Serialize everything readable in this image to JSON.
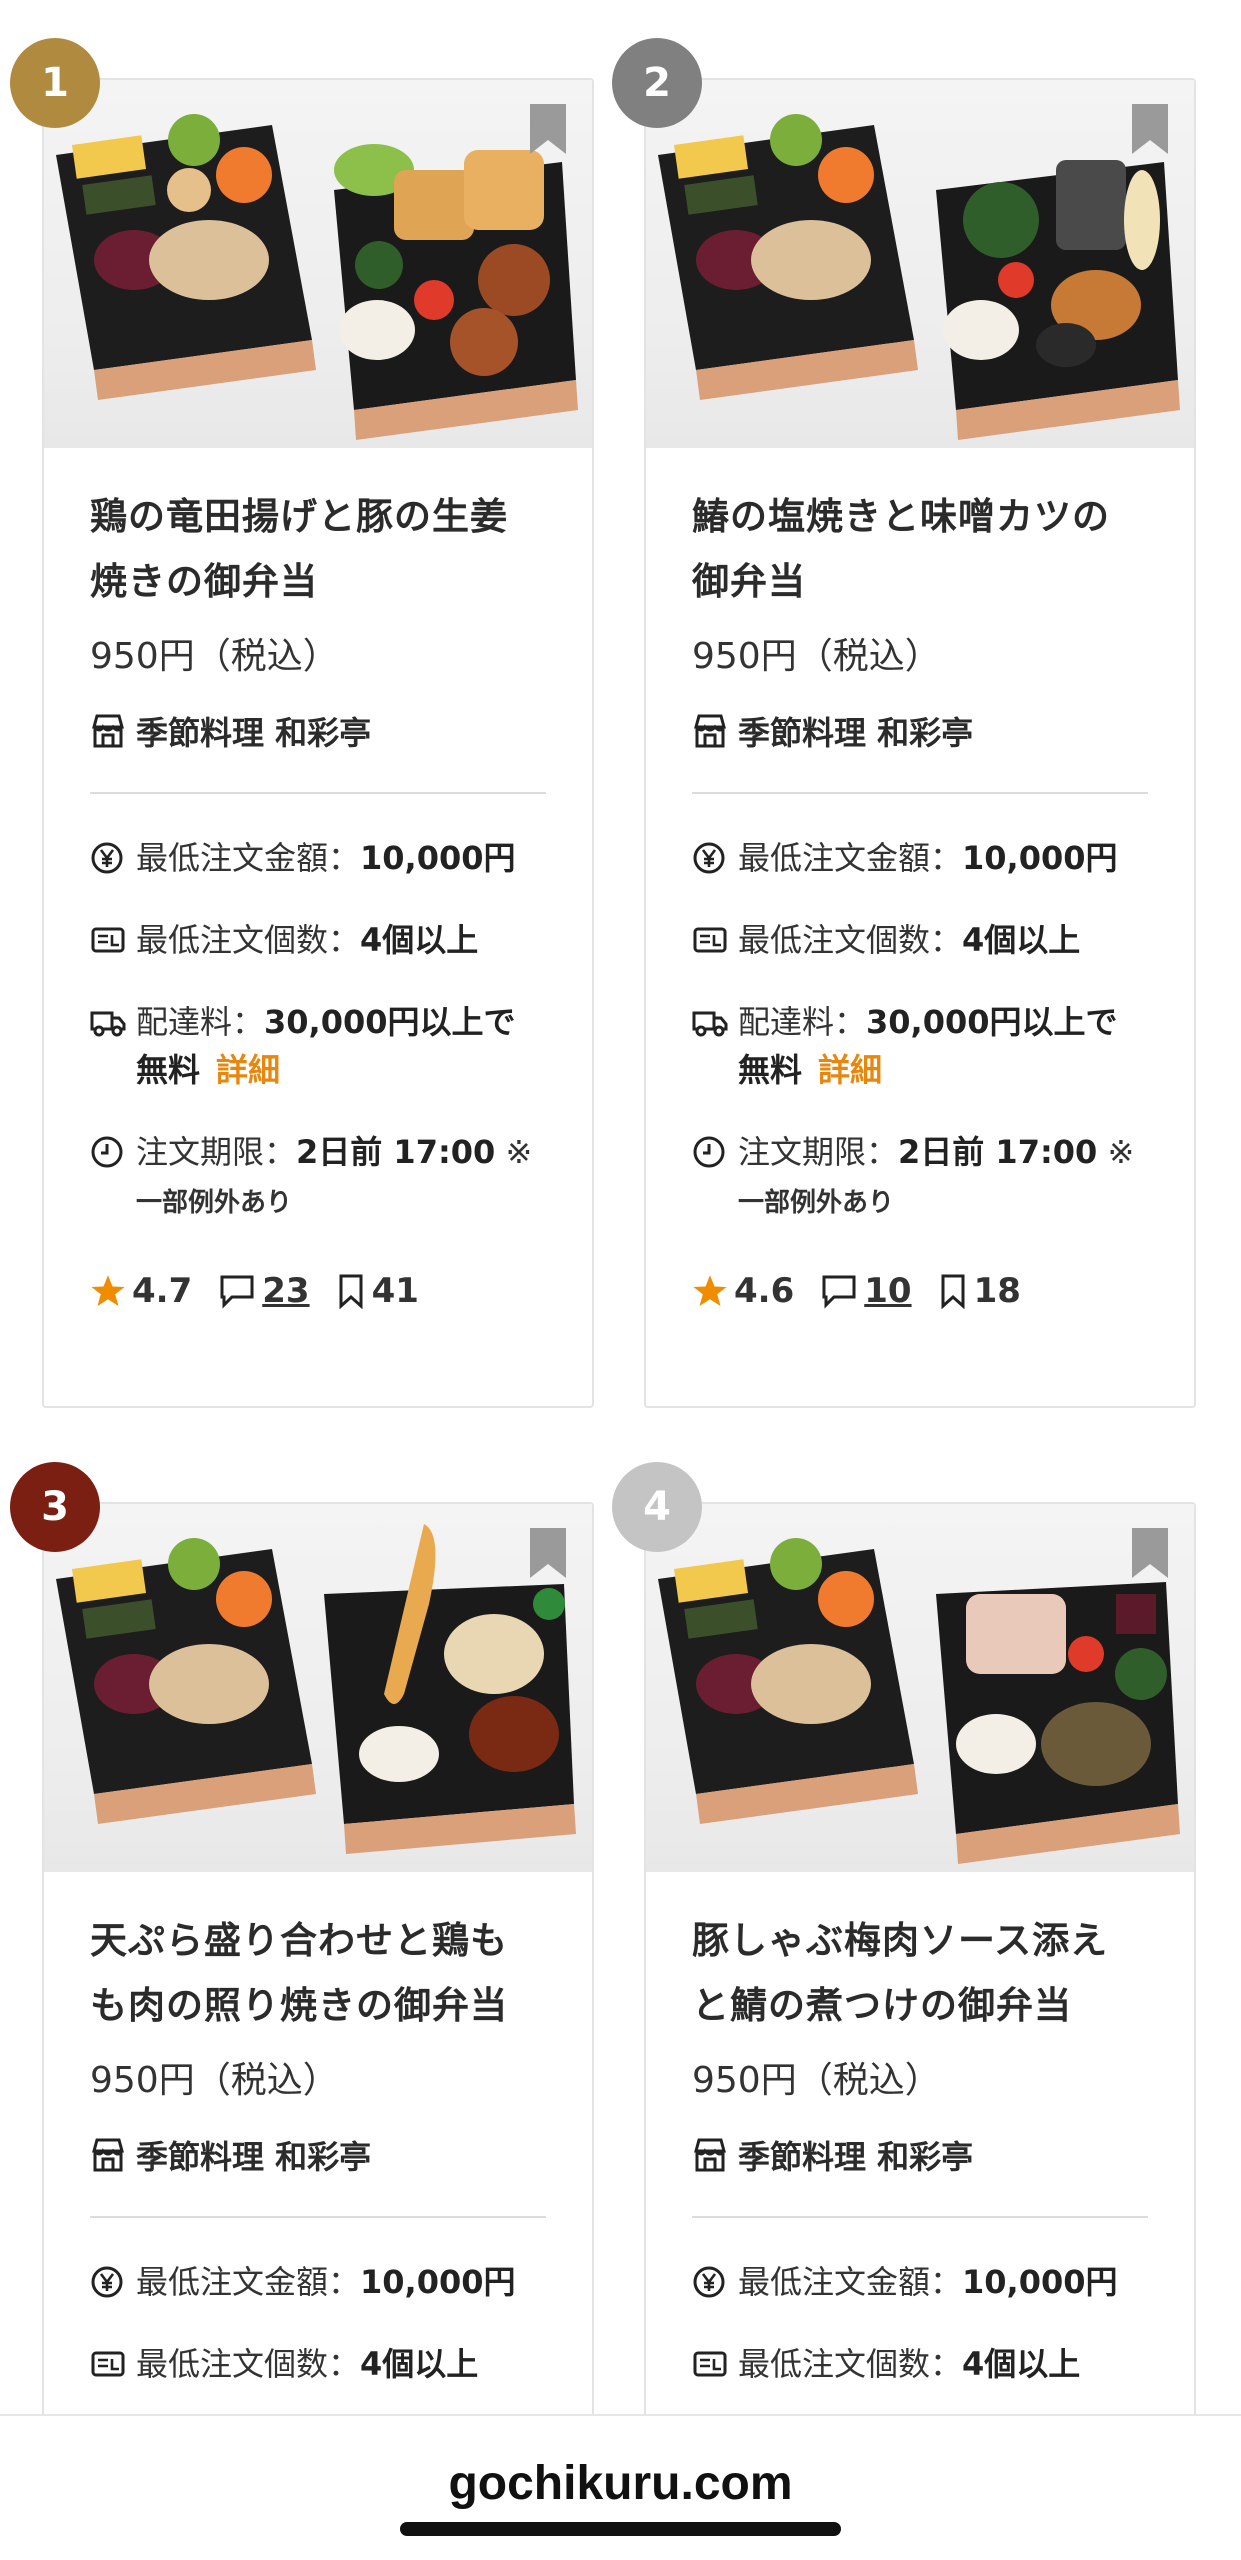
{
  "footer": {
    "domain": "gochikuru.com"
  },
  "colors": {
    "accent_orange": "#e8870e",
    "star": "#f08c00",
    "rank1": "#b08a3e",
    "rank2": "#808080",
    "rank3": "#7a1f12",
    "rank4": "#c4c4c4"
  },
  "cards": [
    {
      "rank": "1",
      "title_line1": "鶏の竜田揚げと豚の生姜",
      "title_line2": "焼きの御弁当",
      "price": "950円（税込）",
      "shop": "季節料理 和彩亭",
      "min_amount_label": "最低注文金額：",
      "min_amount_value": "10,000円",
      "min_qty_label": "最低注文個数：",
      "min_qty_value": "4個以上",
      "delivery_label": "配達料：",
      "delivery_value_1": "30,000円以上で",
      "delivery_value_2": "無料",
      "detail_link": "詳細",
      "deadline_label": "注文期限：",
      "deadline_value": "2日前 17:00",
      "deadline_mark": "※",
      "deadline_note": "一部例外あり",
      "rating": "4.7",
      "comments": "23",
      "bookmarks": "41"
    },
    {
      "rank": "2",
      "title_line1": "鰆の塩焼きと味噌カツの",
      "title_line2": "御弁当",
      "price": "950円（税込）",
      "shop": "季節料理 和彩亭",
      "min_amount_label": "最低注文金額：",
      "min_amount_value": "10,000円",
      "min_qty_label": "最低注文個数：",
      "min_qty_value": "4個以上",
      "delivery_label": "配達料：",
      "delivery_value_1": "30,000円以上で",
      "delivery_value_2": "無料",
      "detail_link": "詳細",
      "deadline_label": "注文期限：",
      "deadline_value": "2日前 17:00",
      "deadline_mark": "※",
      "deadline_note": "一部例外あり",
      "rating": "4.6",
      "comments": "10",
      "bookmarks": "18"
    },
    {
      "rank": "3",
      "title_line1": "天ぷら盛り合わせと鶏も",
      "title_line2": "も肉の照り焼きの御弁当",
      "price": "950円（税込）",
      "shop": "季節料理 和彩亭",
      "min_amount_label": "最低注文金額：",
      "min_amount_value": "10,000円",
      "min_qty_label": "最低注文個数：",
      "min_qty_value": "4個以上"
    },
    {
      "rank": "4",
      "title_line1": "豚しゃぶ梅肉ソース添え",
      "title_line2": "と鯖の煮つけの御弁当",
      "price": "950円（税込）",
      "shop": "季節料理 和彩亭",
      "min_amount_label": "最低注文金額：",
      "min_amount_value": "10,000円",
      "min_qty_label": "最低注文個数：",
      "min_qty_value": "4個以上"
    }
  ]
}
